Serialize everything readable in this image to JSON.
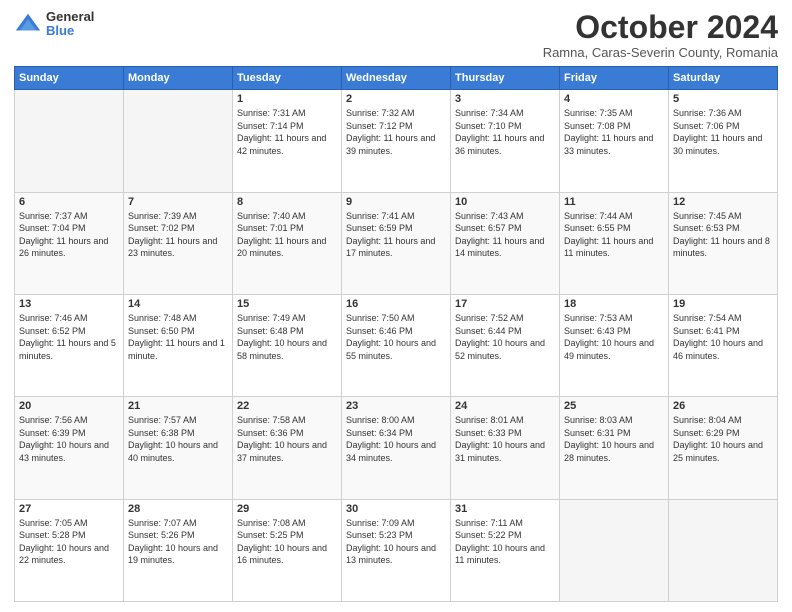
{
  "logo": {
    "general": "General",
    "blue": "Blue"
  },
  "header": {
    "month": "October 2024",
    "location": "Ramna, Caras-Severin County, Romania"
  },
  "days_of_week": [
    "Sunday",
    "Monday",
    "Tuesday",
    "Wednesday",
    "Thursday",
    "Friday",
    "Saturday"
  ],
  "weeks": [
    [
      {
        "day": "",
        "sunrise": "",
        "sunset": "",
        "daylight": "",
        "empty": true
      },
      {
        "day": "",
        "sunrise": "",
        "sunset": "",
        "daylight": "",
        "empty": true
      },
      {
        "day": "1",
        "sunrise": "Sunrise: 7:31 AM",
        "sunset": "Sunset: 7:14 PM",
        "daylight": "Daylight: 11 hours and 42 minutes."
      },
      {
        "day": "2",
        "sunrise": "Sunrise: 7:32 AM",
        "sunset": "Sunset: 7:12 PM",
        "daylight": "Daylight: 11 hours and 39 minutes."
      },
      {
        "day": "3",
        "sunrise": "Sunrise: 7:34 AM",
        "sunset": "Sunset: 7:10 PM",
        "daylight": "Daylight: 11 hours and 36 minutes."
      },
      {
        "day": "4",
        "sunrise": "Sunrise: 7:35 AM",
        "sunset": "Sunset: 7:08 PM",
        "daylight": "Daylight: 11 hours and 33 minutes."
      },
      {
        "day": "5",
        "sunrise": "Sunrise: 7:36 AM",
        "sunset": "Sunset: 7:06 PM",
        "daylight": "Daylight: 11 hours and 30 minutes."
      }
    ],
    [
      {
        "day": "6",
        "sunrise": "Sunrise: 7:37 AM",
        "sunset": "Sunset: 7:04 PM",
        "daylight": "Daylight: 11 hours and 26 minutes."
      },
      {
        "day": "7",
        "sunrise": "Sunrise: 7:39 AM",
        "sunset": "Sunset: 7:02 PM",
        "daylight": "Daylight: 11 hours and 23 minutes."
      },
      {
        "day": "8",
        "sunrise": "Sunrise: 7:40 AM",
        "sunset": "Sunset: 7:01 PM",
        "daylight": "Daylight: 11 hours and 20 minutes."
      },
      {
        "day": "9",
        "sunrise": "Sunrise: 7:41 AM",
        "sunset": "Sunset: 6:59 PM",
        "daylight": "Daylight: 11 hours and 17 minutes."
      },
      {
        "day": "10",
        "sunrise": "Sunrise: 7:43 AM",
        "sunset": "Sunset: 6:57 PM",
        "daylight": "Daylight: 11 hours and 14 minutes."
      },
      {
        "day": "11",
        "sunrise": "Sunrise: 7:44 AM",
        "sunset": "Sunset: 6:55 PM",
        "daylight": "Daylight: 11 hours and 11 minutes."
      },
      {
        "day": "12",
        "sunrise": "Sunrise: 7:45 AM",
        "sunset": "Sunset: 6:53 PM",
        "daylight": "Daylight: 11 hours and 8 minutes."
      }
    ],
    [
      {
        "day": "13",
        "sunrise": "Sunrise: 7:46 AM",
        "sunset": "Sunset: 6:52 PM",
        "daylight": "Daylight: 11 hours and 5 minutes."
      },
      {
        "day": "14",
        "sunrise": "Sunrise: 7:48 AM",
        "sunset": "Sunset: 6:50 PM",
        "daylight": "Daylight: 11 hours and 1 minute."
      },
      {
        "day": "15",
        "sunrise": "Sunrise: 7:49 AM",
        "sunset": "Sunset: 6:48 PM",
        "daylight": "Daylight: 10 hours and 58 minutes."
      },
      {
        "day": "16",
        "sunrise": "Sunrise: 7:50 AM",
        "sunset": "Sunset: 6:46 PM",
        "daylight": "Daylight: 10 hours and 55 minutes."
      },
      {
        "day": "17",
        "sunrise": "Sunrise: 7:52 AM",
        "sunset": "Sunset: 6:44 PM",
        "daylight": "Daylight: 10 hours and 52 minutes."
      },
      {
        "day": "18",
        "sunrise": "Sunrise: 7:53 AM",
        "sunset": "Sunset: 6:43 PM",
        "daylight": "Daylight: 10 hours and 49 minutes."
      },
      {
        "day": "19",
        "sunrise": "Sunrise: 7:54 AM",
        "sunset": "Sunset: 6:41 PM",
        "daylight": "Daylight: 10 hours and 46 minutes."
      }
    ],
    [
      {
        "day": "20",
        "sunrise": "Sunrise: 7:56 AM",
        "sunset": "Sunset: 6:39 PM",
        "daylight": "Daylight: 10 hours and 43 minutes."
      },
      {
        "day": "21",
        "sunrise": "Sunrise: 7:57 AM",
        "sunset": "Sunset: 6:38 PM",
        "daylight": "Daylight: 10 hours and 40 minutes."
      },
      {
        "day": "22",
        "sunrise": "Sunrise: 7:58 AM",
        "sunset": "Sunset: 6:36 PM",
        "daylight": "Daylight: 10 hours and 37 minutes."
      },
      {
        "day": "23",
        "sunrise": "Sunrise: 8:00 AM",
        "sunset": "Sunset: 6:34 PM",
        "daylight": "Daylight: 10 hours and 34 minutes."
      },
      {
        "day": "24",
        "sunrise": "Sunrise: 8:01 AM",
        "sunset": "Sunset: 6:33 PM",
        "daylight": "Daylight: 10 hours and 31 minutes."
      },
      {
        "day": "25",
        "sunrise": "Sunrise: 8:03 AM",
        "sunset": "Sunset: 6:31 PM",
        "daylight": "Daylight: 10 hours and 28 minutes."
      },
      {
        "day": "26",
        "sunrise": "Sunrise: 8:04 AM",
        "sunset": "Sunset: 6:29 PM",
        "daylight": "Daylight: 10 hours and 25 minutes."
      }
    ],
    [
      {
        "day": "27",
        "sunrise": "Sunrise: 7:05 AM",
        "sunset": "Sunset: 5:28 PM",
        "daylight": "Daylight: 10 hours and 22 minutes."
      },
      {
        "day": "28",
        "sunrise": "Sunrise: 7:07 AM",
        "sunset": "Sunset: 5:26 PM",
        "daylight": "Daylight: 10 hours and 19 minutes."
      },
      {
        "day": "29",
        "sunrise": "Sunrise: 7:08 AM",
        "sunset": "Sunset: 5:25 PM",
        "daylight": "Daylight: 10 hours and 16 minutes."
      },
      {
        "day": "30",
        "sunrise": "Sunrise: 7:09 AM",
        "sunset": "Sunset: 5:23 PM",
        "daylight": "Daylight: 10 hours and 13 minutes."
      },
      {
        "day": "31",
        "sunrise": "Sunrise: 7:11 AM",
        "sunset": "Sunset: 5:22 PM",
        "daylight": "Daylight: 10 hours and 11 minutes."
      },
      {
        "day": "",
        "sunrise": "",
        "sunset": "",
        "daylight": "",
        "empty": true
      },
      {
        "day": "",
        "sunrise": "",
        "sunset": "",
        "daylight": "",
        "empty": true
      }
    ]
  ]
}
